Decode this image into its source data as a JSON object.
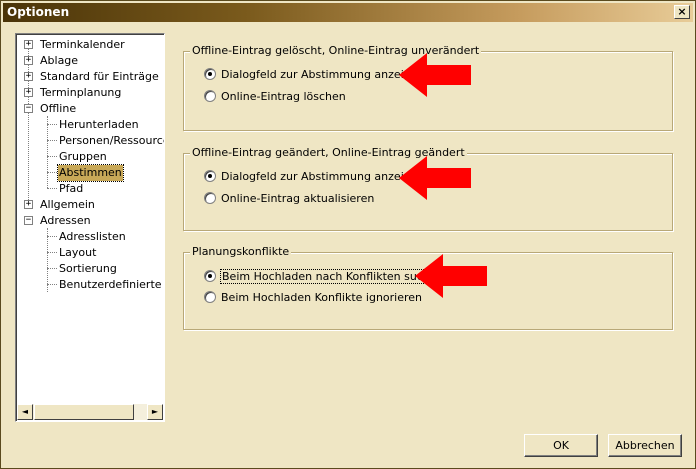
{
  "window": {
    "title": "Optionen",
    "close_glyph": "×"
  },
  "tree": {
    "items": [
      {
        "label": "Terminkalender",
        "expander": "+"
      },
      {
        "label": "Ablage",
        "expander": "+"
      },
      {
        "label": "Standard für Einträge",
        "expander": "+"
      },
      {
        "label": "Terminplanung",
        "expander": "+"
      },
      {
        "label": "Offline",
        "expander": "−"
      },
      {
        "label": "Herunterladen"
      },
      {
        "label": "Personen/Ressourcen"
      },
      {
        "label": "Gruppen"
      },
      {
        "label": "Abstimmen",
        "selected": true
      },
      {
        "label": "Pfad"
      },
      {
        "label": "Allgemein",
        "expander": "+"
      },
      {
        "label": "Adressen",
        "expander": "−"
      },
      {
        "label": "Adresslisten"
      },
      {
        "label": "Layout"
      },
      {
        "label": "Sortierung"
      },
      {
        "label": "Benutzerdefinierte Felder"
      }
    ],
    "scroll_left": "◄",
    "scroll_right": "►"
  },
  "groups": [
    {
      "title": "Offline-Eintrag gelöscht, Online-Eintrag unverändert",
      "options": [
        {
          "label": "Dialogfeld zur Abstimmung anzeigen",
          "checked": true
        },
        {
          "label": "Online-Eintrag löschen",
          "checked": false
        }
      ]
    },
    {
      "title": "Offline-Eintrag geändert, Online-Eintrag geändert",
      "options": [
        {
          "label": "Dialogfeld zur Abstimmung anzeigen",
          "checked": true
        },
        {
          "label": "Online-Eintrag aktualisieren",
          "checked": false
        }
      ]
    },
    {
      "title": "Planungskonflikte",
      "options": [
        {
          "label": "Beim Hochladen nach Konflikten suchen",
          "checked": true
        },
        {
          "label": "Beim Hochladen Konflikte ignorieren",
          "checked": false
        }
      ]
    }
  ],
  "buttons": {
    "ok": "OK",
    "cancel": "Abbrechen"
  },
  "colors": {
    "dialog_bg": "#efe6c4",
    "selection": "#c8a858",
    "arrow": "#ff0000"
  }
}
